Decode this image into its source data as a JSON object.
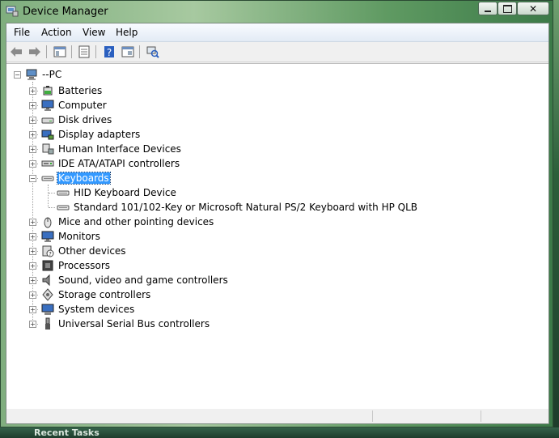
{
  "window": {
    "title": "Device Manager"
  },
  "menubar": {
    "items": [
      "File",
      "Action",
      "View",
      "Help"
    ]
  },
  "toolbar": {
    "buttons": [
      "back-icon",
      "forward-icon",
      "show-hide-tree-icon",
      "properties-icon",
      "help-icon",
      "view-icon",
      "scan-hardware-icon"
    ]
  },
  "tree": {
    "root": {
      "label": "--PC",
      "icon": "computer-icon",
      "expanded": true
    },
    "categories": [
      {
        "label": "Batteries",
        "icon": "battery-icon",
        "expanded": false
      },
      {
        "label": "Computer",
        "icon": "monitor-icon",
        "expanded": false
      },
      {
        "label": "Disk drives",
        "icon": "disk-drive-icon",
        "expanded": false
      },
      {
        "label": "Display adapters",
        "icon": "display-adapter-icon",
        "expanded": false
      },
      {
        "label": "Human Interface Devices",
        "icon": "hid-icon",
        "expanded": false
      },
      {
        "label": "IDE ATA/ATAPI controllers",
        "icon": "ide-controller-icon",
        "expanded": false
      },
      {
        "label": "Keyboards",
        "icon": "keyboard-icon",
        "expanded": true,
        "selected": true,
        "children": [
          {
            "label": "HID Keyboard Device",
            "icon": "keyboard-icon"
          },
          {
            "label": "Standard 101/102-Key or Microsoft Natural PS/2 Keyboard with HP QLB",
            "icon": "keyboard-icon"
          }
        ]
      },
      {
        "label": "Mice and other pointing devices",
        "icon": "mouse-icon",
        "expanded": false
      },
      {
        "label": "Monitors",
        "icon": "monitor-icon",
        "expanded": false
      },
      {
        "label": "Other devices",
        "icon": "unknown-device-icon",
        "expanded": false
      },
      {
        "label": "Processors",
        "icon": "processor-icon",
        "expanded": false
      },
      {
        "label": "Sound, video and game controllers",
        "icon": "speaker-icon",
        "expanded": false
      },
      {
        "label": "Storage controllers",
        "icon": "storage-controller-icon",
        "expanded": false
      },
      {
        "label": "System devices",
        "icon": "system-device-icon",
        "expanded": false
      },
      {
        "label": "Universal Serial Bus controllers",
        "icon": "usb-icon",
        "expanded": false
      }
    ]
  },
  "desktop": {
    "behind_text": "Recent Tasks"
  },
  "colors": {
    "selection": "#3399ff",
    "titlebar_accent": "#7fae7e"
  }
}
